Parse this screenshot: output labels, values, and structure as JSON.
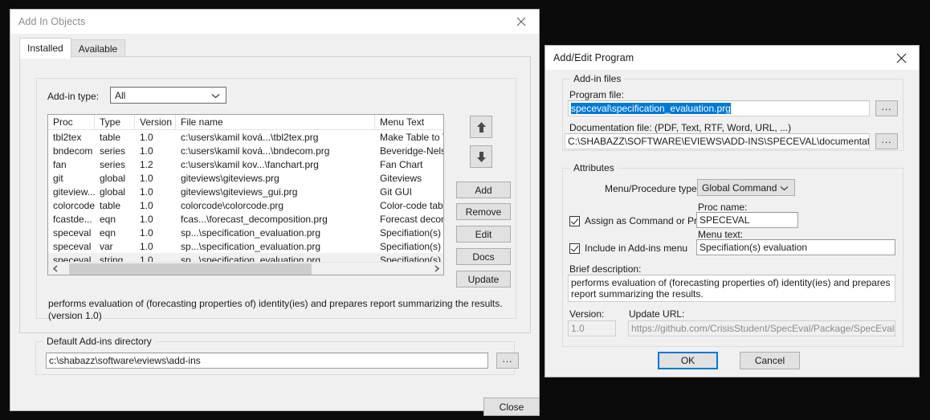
{
  "desktop": {
    "background": "#0b0b0b"
  },
  "addin_dialog": {
    "title": "Add In Objects",
    "close_icon": "close-icon",
    "tabs": [
      {
        "label": "Installed",
        "active": true
      },
      {
        "label": "Available",
        "active": false
      }
    ],
    "addin_type": {
      "label": "Add-in type:",
      "value": "All",
      "chevron_icon": "chevron-down-icon"
    },
    "table": {
      "columns": [
        "Proc",
        "Type",
        "Version",
        "File name",
        "Menu Text"
      ],
      "rows": [
        {
          "proc": "tbl2tex",
          "type": "table",
          "version": "1.0",
          "file": "c:\\users\\kamil ková...\\tbl2tex.prg",
          "menu": "Make Table to Te",
          "selected": false
        },
        {
          "proc": "bndecom",
          "type": "series",
          "version": "1.0",
          "file": "c:\\users\\kamil ková...\\bndecom.prg",
          "menu": "Beveridge-Nelso",
          "selected": false
        },
        {
          "proc": "fan",
          "type": "series",
          "version": "1.2",
          "file": "c:\\users\\kamil kov...\\fanchart.prg",
          "menu": "Fan Chart",
          "selected": false
        },
        {
          "proc": "git",
          "type": "global",
          "version": "1.0",
          "file": "giteviews\\giteviews.prg",
          "menu": "Giteviews",
          "selected": false
        },
        {
          "proc": "giteview...",
          "type": "global",
          "version": "1.0",
          "file": "giteviews\\giteviews_gui.prg",
          "menu": "Git GUI",
          "selected": false
        },
        {
          "proc": "colorcode",
          "type": "table",
          "version": "1.0",
          "file": "colorcode\\colorcode.prg",
          "menu": "Color-code table",
          "selected": false
        },
        {
          "proc": "fcastde...",
          "type": "eqn",
          "version": "1.0",
          "file": "fcas...\\forecast_decomposition.prg",
          "menu": "Forecast decomp",
          "selected": false
        },
        {
          "proc": "speceval",
          "type": "eqn",
          "version": "1.0",
          "file": "sp...\\specification_evaluation.prg",
          "menu": "Speciﬁation(s) e",
          "selected": false
        },
        {
          "proc": "speceval",
          "type": "var",
          "version": "1.0",
          "file": "sp...\\specification_evaluation.prg",
          "menu": "Speciﬁation(s) e",
          "selected": false
        },
        {
          "proc": "speceval",
          "type": "string",
          "version": "1.0",
          "file": "sp...\\specification_evaluation.prg",
          "menu": "Speciﬁation(s) e",
          "selected": true
        }
      ],
      "scrollbar": {
        "left_arrow_icon": "scroll-left-icon",
        "right_arrow_icon": "scroll-right-icon",
        "thumb_start_pct": 2,
        "thumb_width_pct": 66
      }
    },
    "side_buttons": {
      "move_up_icon": "arrow-up-icon",
      "move_down_icon": "arrow-down-icon",
      "add": "Add",
      "remove": "Remove",
      "edit": "Edit",
      "docs": "Docs",
      "update": "Update"
    },
    "description": "performs evaluation of (forecasting properties of) identity(ies) and prepares report summarizing the results. (version 1.0)",
    "default_dir": {
      "group_label": "Default Add-ins directory",
      "value": "c:\\shabazz\\software\\eviews\\add-ins",
      "browse_label": "..."
    },
    "close_button": "Close"
  },
  "program_dialog": {
    "title": "Add/Edit Program",
    "close_icon": "close-icon",
    "files_group": {
      "label": "Add-in files",
      "program_file_label": "Program file:",
      "program_file_value": "speceval\\specification_evaluation.prg",
      "program_file_selected": true,
      "program_browse_label": "...",
      "doc_file_label": "Documentation file:  (PDF, Text, RTF, Word, URL, ...)",
      "doc_file_value": "C:\\SHABAZZ\\SOFTWARE\\EVIEWS\\ADD-INS\\SPECEVAL\\documentation\\specifi",
      "doc_browse_label": "..."
    },
    "attributes_group": {
      "label": "Attributes",
      "menu_type_label": "Menu/Procedure type:",
      "menu_type_value": "Global Command",
      "menu_type_chevron": "chevron-down-icon",
      "assign_checkbox_label": "Assign as Command or Proc",
      "assign_checked": true,
      "proc_name_label": "Proc name:",
      "proc_name_value": "SPECEVAL",
      "include_checkbox_label": "Include in Add-ins menu",
      "include_checked": true,
      "menu_text_label": "Menu text:",
      "menu_text_value": "Speciﬁation(s) evaluation",
      "brief_desc_label": "Brief description:",
      "brief_desc_value": "performs evaluation of (forecasting properties of) identity(ies) and prepares report summarizing the results.",
      "version_label": "Version:",
      "version_value": "1.0",
      "update_url_label": "Update URL:",
      "update_url_value": "https://github.com/CrisisStudent/SpecEval/Package/SpecEval.aipz"
    },
    "ok_button": "OK",
    "cancel_button": "Cancel"
  },
  "colors": {
    "accent": "#0078d7",
    "selection_bg": "#0078d7",
    "dialog_bg": "#f0f0f0",
    "field_bg": "#ffffff",
    "row_selected_bg": "#f0f0f0"
  }
}
